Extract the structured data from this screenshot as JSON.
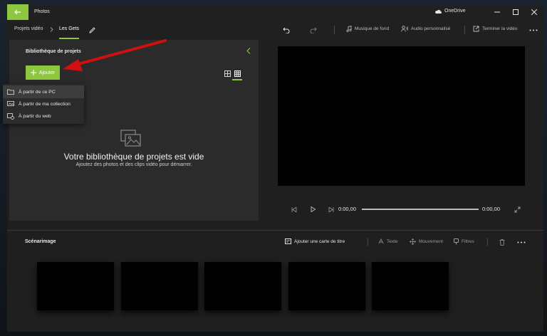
{
  "window": {
    "title": "Photos"
  },
  "onedrive": {
    "label": "OneDrive"
  },
  "breadcrumb": {
    "parent": "Projets vidéo",
    "current": "Les Gets"
  },
  "toolbar": {
    "music": "Musique de fond",
    "custom_audio": "Audio personnalisé",
    "finish": "Terminer la vidéo"
  },
  "library": {
    "title": "Bibliothèque de projets",
    "add_label": "Ajouter",
    "empty_title": "Votre bibliothèque de projets est vide",
    "empty_subtitle": "Ajoutez des photos et des clips vidéo pour démarrer."
  },
  "add_menu": {
    "items": [
      "À partir de ce PC",
      "À partir de ma collection",
      "À partir du web"
    ],
    "selected_index": 0
  },
  "player": {
    "current_time": "0:00,00",
    "total_time": "0:00,00",
    "progress": 0
  },
  "storyboard": {
    "title": "Scénarimage",
    "add_title_card": "Ajouter une carte de titre",
    "text": "Texte",
    "motion": "Mouvement",
    "filters": "Filtres"
  },
  "colors": {
    "accent": "#8dc63f",
    "annotation": "#d01010",
    "panel": "#2b2b2b",
    "background": "#1f1f1f"
  },
  "icons": {
    "back": "arrow-left-icon",
    "cloud": "cloud-icon",
    "edit": "pencil-icon",
    "undo": "undo-icon",
    "redo": "redo-icon",
    "music": "music-note-icon",
    "audio": "person-audio-icon",
    "export": "export-icon",
    "more": "more-icon",
    "plus": "plus-icon",
    "grid": "grid-icon",
    "empty": "images-icon"
  }
}
